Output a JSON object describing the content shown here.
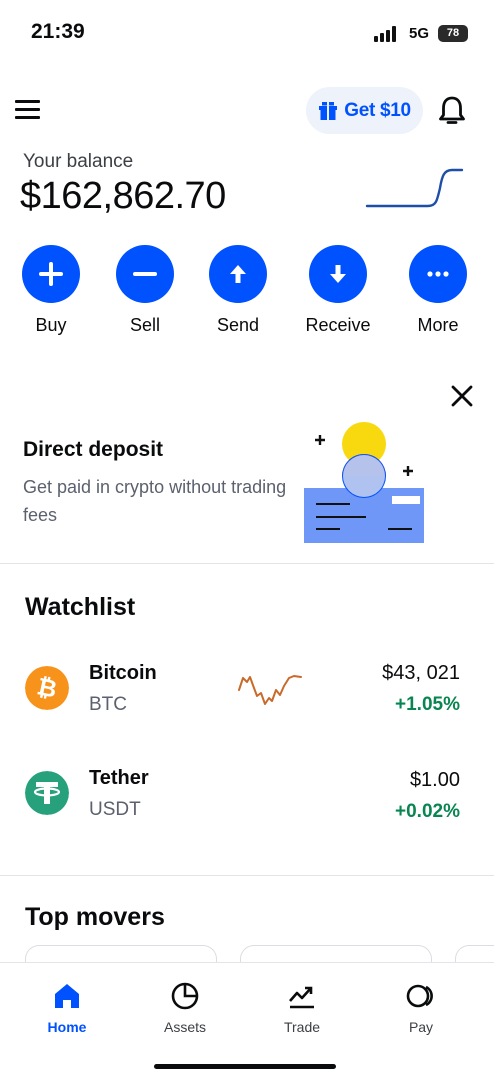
{
  "status_bar": {
    "time": "21:39",
    "network": "5G",
    "battery": "78"
  },
  "header": {
    "promo_label": "Get $10"
  },
  "balance": {
    "label": "Your balance",
    "value": "$162,862.70"
  },
  "actions": [
    {
      "label": "Buy",
      "icon": "plus-icon"
    },
    {
      "label": "Sell",
      "icon": "minus-icon"
    },
    {
      "label": "Send",
      "icon": "arrow-up-icon"
    },
    {
      "label": "Receive",
      "icon": "arrow-down-icon"
    },
    {
      "label": "More",
      "icon": "more-icon"
    }
  ],
  "promo_card": {
    "title": "Direct deposit",
    "description": "Get paid in crypto without trading fees"
  },
  "watchlist": {
    "title": "Watchlist",
    "items": [
      {
        "name": "Bitcoin",
        "ticker": "BTC",
        "price": "$43, 021",
        "change": "+1.05%",
        "icon_color": "#f7931a"
      },
      {
        "name": "Tether",
        "ticker": "USDT",
        "price": "$1.00",
        "change": "+0.02%",
        "icon_color": "#26a17b"
      }
    ]
  },
  "top_movers": {
    "title": "Top movers"
  },
  "bottom_nav": [
    {
      "label": "Home",
      "icon": "home-icon",
      "active": true
    },
    {
      "label": "Assets",
      "icon": "pie-chart-icon",
      "active": false
    },
    {
      "label": "Trade",
      "icon": "trade-chart-icon",
      "active": false
    },
    {
      "label": "Pay",
      "icon": "pay-icon",
      "active": false
    }
  ],
  "colors": {
    "brand": "#0052ff",
    "positive": "#098551",
    "spark": "#c96a2b"
  }
}
